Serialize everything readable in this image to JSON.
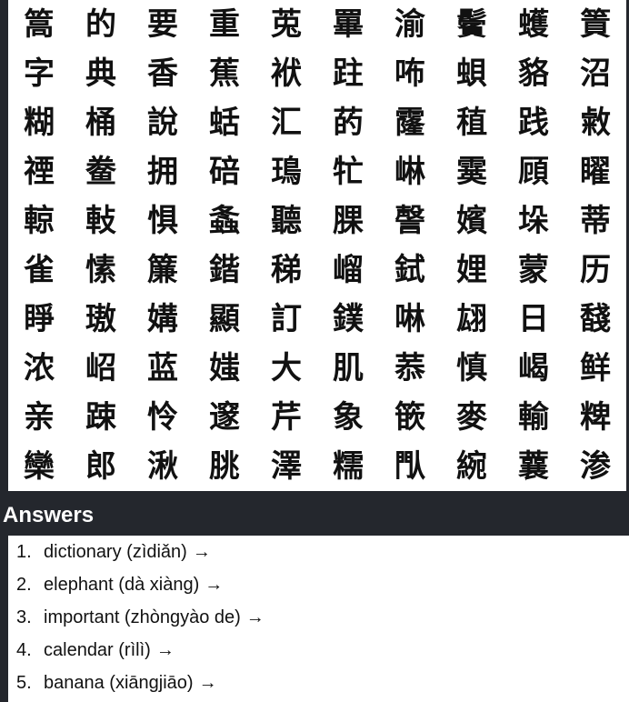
{
  "grid": {
    "rows": [
      [
        "篙",
        "的",
        "要",
        "重",
        "莵",
        "罼",
        "渝",
        "鬢",
        "蠖",
        "篢"
      ],
      [
        "字",
        "典",
        "香",
        "蕉",
        "袱",
        "跓",
        "咘",
        "蛽",
        "貉",
        "沼"
      ],
      [
        "糊",
        "桶",
        "說",
        "蛞",
        "汇",
        "菂",
        "霳",
        "稙",
        "践",
        "敹"
      ],
      [
        "禋",
        "鲞",
        "拥",
        "碚",
        "鳿",
        "牤",
        "崊",
        "霙",
        "頋",
        "矅"
      ],
      [
        "輬",
        "軙",
        "惧",
        "螽",
        "聽",
        "腂",
        "謦",
        "嬪",
        "垛",
        "蒂"
      ],
      [
        "雀",
        "愫",
        "簾",
        "鍇",
        "稊",
        "嵧",
        "鉽",
        "娌",
        "蒙",
        "历"
      ],
      [
        "睜",
        "璈",
        "媾",
        "顯",
        "訂",
        "鏷",
        "啉",
        "翃",
        "日",
        "馢"
      ],
      [
        "浓",
        "岹",
        "蓝",
        "媸",
        "大",
        "肌",
        "菾",
        "慎",
        "嵑",
        "鲜"
      ],
      [
        "亲",
        "踈",
        "怜",
        "邃",
        "芹",
        "象",
        "篏",
        "麥",
        "輸",
        "粺"
      ],
      [
        "欒",
        "郎",
        "湫",
        "朓",
        "澤",
        "糯",
        "閄",
        "綩",
        "蘘",
        "渗"
      ]
    ]
  },
  "answers": {
    "title": "Answers",
    "items": [
      {
        "num": "1.",
        "text": "dictionary (zìdiǎn)",
        "arrow": "→"
      },
      {
        "num": "2.",
        "text": "elephant (dà xiàng)",
        "arrow": "→"
      },
      {
        "num": "3.",
        "text": "important (zhòngyào de)",
        "arrow": "→"
      },
      {
        "num": "4.",
        "text": "calendar (rìlì)",
        "arrow": "→"
      },
      {
        "num": "5.",
        "text": "banana (xiāngjiāo)",
        "arrow": "→"
      }
    ]
  }
}
